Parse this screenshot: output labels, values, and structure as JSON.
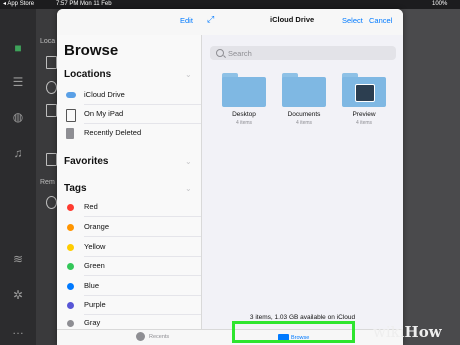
{
  "status_bar": {
    "carrier": "◂ App Store",
    "time": "7:57 PM",
    "date": "Mon 11 Feb",
    "battery": "100%"
  },
  "background": {
    "panel_labels": [
      "Loca",
      "Rem"
    ]
  },
  "modal": {
    "edit_label": "Edit",
    "title": "iCloud Drive",
    "select_label": "Select",
    "cancel_label": "Cancel",
    "browse_heading": "Browse",
    "sections": {
      "locations": "Locations",
      "favorites": "Favorites",
      "tags": "Tags"
    },
    "locations": [
      {
        "label": "iCloud Drive"
      },
      {
        "label": "On My iPad"
      },
      {
        "label": "Recently Deleted"
      }
    ],
    "tags": [
      {
        "label": "Red",
        "color": "#ff3b30"
      },
      {
        "label": "Orange",
        "color": "#ff9500"
      },
      {
        "label": "Yellow",
        "color": "#ffcc00"
      },
      {
        "label": "Green",
        "color": "#34c759"
      },
      {
        "label": "Blue",
        "color": "#007aff"
      },
      {
        "label": "Purple",
        "color": "#5856d6"
      },
      {
        "label": "Gray",
        "color": "#8e8e93"
      }
    ],
    "search_placeholder": "Search",
    "folders": [
      {
        "name": "Desktop",
        "subtitle": "4 items"
      },
      {
        "name": "Documents",
        "subtitle": "4 items"
      },
      {
        "name": "Preview",
        "subtitle": "4 items"
      }
    ],
    "storage_info": "3 items, 1.03 GB available on iCloud",
    "tabbar": {
      "recents": "Recents",
      "browse": "Browse"
    }
  },
  "watermark": {
    "wiki": "wiki",
    "how": "How"
  },
  "colors": {
    "accent": "#007aff",
    "highlight": "#2ee52e",
    "app_green": "#3ea35a"
  }
}
